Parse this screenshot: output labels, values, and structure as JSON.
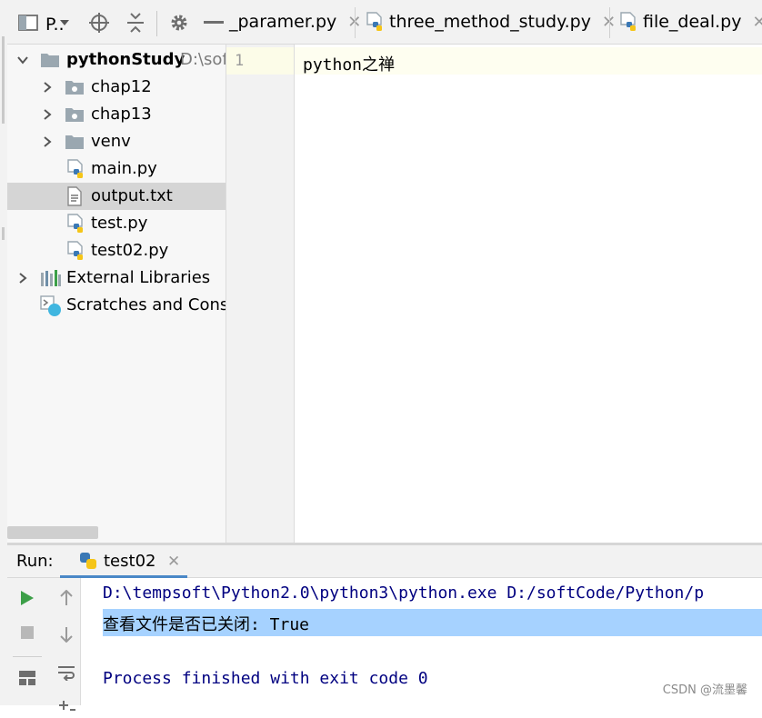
{
  "toolbar": {
    "project_label": "P..",
    "icons": [
      "project-view-icon",
      "dropdown-icon",
      "target-icon",
      "collapse-all-icon",
      "gear-icon",
      "minimize-icon"
    ]
  },
  "tabs": [
    {
      "label": "_paramer.py",
      "icon": "python-file-icon"
    },
    {
      "label": "three_method_study.py",
      "icon": "python-file-icon"
    },
    {
      "label": "file_deal.py",
      "icon": "python-file-icon"
    }
  ],
  "tree": {
    "root": {
      "name": "pythonStudy",
      "hint": "D:\\sof"
    },
    "items": [
      {
        "label": "chap12",
        "icon": "folder-icon"
      },
      {
        "label": "chap13",
        "icon": "folder-icon"
      },
      {
        "label": "venv",
        "icon": "folder-icon"
      },
      {
        "label": "main.py",
        "icon": "python-file-icon"
      },
      {
        "label": "output.txt",
        "icon": "text-file-icon",
        "selected": true
      },
      {
        "label": "test.py",
        "icon": "python-file-icon"
      },
      {
        "label": "test02.py",
        "icon": "python-file-icon"
      },
      {
        "label": "External Libraries",
        "icon": "libraries-icon"
      },
      {
        "label": "Scratches and Conso",
        "icon": "scratches-icon"
      }
    ]
  },
  "editor": {
    "line_number": "1",
    "code": "python之禅"
  },
  "run": {
    "label": "Run:",
    "tab": "test02",
    "console": {
      "command": "D:\\tempsoft\\Python2.0\\python3\\python.exe D:/softCode/Python/p",
      "output": "查看文件是否已关闭:  True",
      "finished": "Process finished with exit code 0"
    }
  },
  "watermark": "CSDN @流墨馨",
  "colors": {
    "selection": "#d5d5d5",
    "console_highlight": "#a6d2ff",
    "console_text": "#000080",
    "run_green": "#3c9f48",
    "tab_underline": "#4a88c7"
  }
}
